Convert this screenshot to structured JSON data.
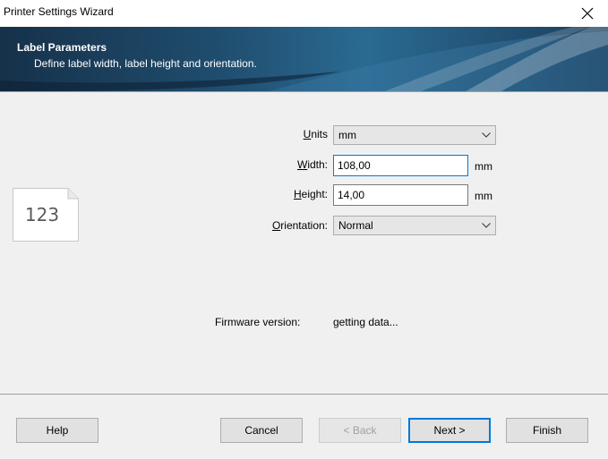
{
  "window": {
    "title": "Printer Settings Wizard",
    "close_icon": "close-icon"
  },
  "banner": {
    "title": "Label Parameters",
    "subtitle": "Define label width, label height and orientation."
  },
  "icon": {
    "text": "123"
  },
  "form": {
    "units": {
      "label_pre": "",
      "label_mn": "U",
      "label_post": "nits",
      "value": "mm"
    },
    "width": {
      "label_mn": "W",
      "label_post": "idth:",
      "value": "108,00",
      "unit": "mm"
    },
    "height": {
      "label_mn": "H",
      "label_post": "eight:",
      "value": "14,00",
      "unit": "mm"
    },
    "orientation": {
      "label_mn": "O",
      "label_post": "rientation:",
      "value": "Normal"
    }
  },
  "firmware": {
    "label": "Firmware version:",
    "value": "getting data..."
  },
  "buttons": {
    "help": "Help",
    "cancel": "Cancel",
    "back": "< Back",
    "next": "Next >",
    "finish": "Finish"
  }
}
